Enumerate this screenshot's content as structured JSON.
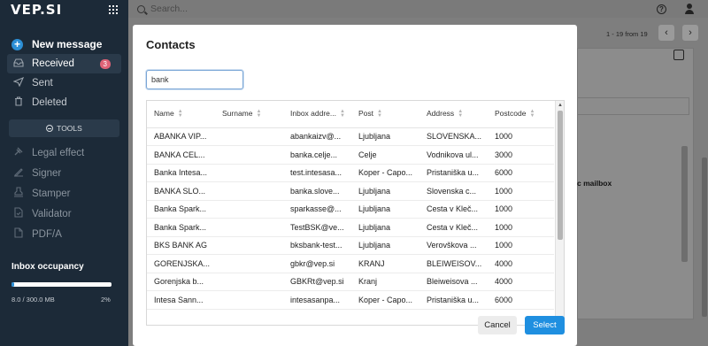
{
  "app": {
    "logo": "VEP.SI"
  },
  "sidebar": {
    "new_message": "New message",
    "items": [
      {
        "label": "Received",
        "icon": "inbox-icon",
        "badge": "3",
        "active": true
      },
      {
        "label": "Sent",
        "icon": "send-icon"
      },
      {
        "label": "Deleted",
        "icon": "trash-icon"
      }
    ],
    "tools_label": "TOOLS",
    "tools": [
      {
        "label": "Legal effect",
        "icon": "gavel-icon"
      },
      {
        "label": "Signer",
        "icon": "signature-icon"
      },
      {
        "label": "Stamper",
        "icon": "stamp-icon"
      },
      {
        "label": "Validator",
        "icon": "document-check-icon"
      },
      {
        "label": "PDF/A",
        "icon": "pdf-icon"
      }
    ],
    "occupancy": {
      "title": "Inbox occupancy",
      "used": "8.0 / 300.0 MB",
      "percent": "2%",
      "fraction": 0.027
    }
  },
  "topbar": {
    "search_placeholder": "Search..."
  },
  "background": {
    "pager": "1 - 19 from 19",
    "prev": "‹",
    "next": "›",
    "mailbox_fragment": "c mailbox"
  },
  "modal": {
    "title": "Contacts",
    "filter_value": "bank",
    "columns": [
      "Name",
      "Surname",
      "Inbox addre...",
      "Post",
      "Address",
      "Postcode"
    ],
    "rows": [
      [
        "ABANKA VIP...",
        "",
        "abankaizv@...",
        "Ljubljana",
        "SLOVENSKA...",
        "1000"
      ],
      [
        "BANKA CEL...",
        "",
        "banka.celje...",
        "Celje",
        "Vodnikova ul...",
        "3000"
      ],
      [
        "Banka Intesa...",
        "",
        "test.intesasa...",
        "Koper - Capo...",
        "Pristaniška u...",
        "6000"
      ],
      [
        "BANKA SLO...",
        "",
        "banka.slove...",
        "Ljubljana",
        "Slovenska c...",
        "1000"
      ],
      [
        "Banka Spark...",
        "",
        "sparkasse@...",
        "Ljubljana",
        "Cesta v Kleč...",
        "1000"
      ],
      [
        "Banka Spark...",
        "",
        "TestBSK@ve...",
        "Ljubljana",
        "Cesta v Kleč...",
        "1000"
      ],
      [
        "BKS BANK AG",
        "",
        "bksbank-test...",
        "Ljubljana",
        "Verovškova ...",
        "1000"
      ],
      [
        "GORENJSKA...",
        "",
        "gbkr@vep.si",
        "KRANJ",
        "BLEIWEISOV...",
        "4000"
      ],
      [
        "Gorenjska b...",
        "",
        "GBKRt@vep.si",
        "Kranj",
        "Bleiweisova ...",
        "4000"
      ],
      [
        "Intesa Sann...",
        "",
        "intesasanpa...",
        "Koper - Capo...",
        "Pristaniška u...",
        "6000"
      ]
    ],
    "cancel_label": "Cancel",
    "select_label": "Select"
  }
}
